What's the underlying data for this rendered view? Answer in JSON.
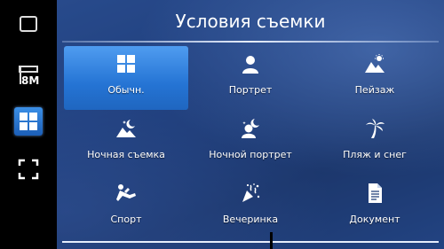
{
  "dialog": {
    "title": "Условия съемки"
  },
  "sidebar": {
    "items": [
      {
        "name": "thumbnail",
        "icon": "thumbnail-icon"
      },
      {
        "name": "resolution",
        "icon": "resolution-icon",
        "label": "8M"
      },
      {
        "name": "scene-mode",
        "icon": "scene-grid-icon",
        "active": true
      },
      {
        "name": "focus",
        "icon": "focus-frame-icon"
      }
    ]
  },
  "scenes": [
    {
      "label": "Обычн.",
      "icon": "grid-icon",
      "selected": true
    },
    {
      "label": "Портрет",
      "icon": "portrait-icon"
    },
    {
      "label": "Пейзаж",
      "icon": "landscape-icon"
    },
    {
      "label": "Ночная съемка",
      "icon": "night-scene-icon"
    },
    {
      "label": "Ночной портрет",
      "icon": "night-portrait-icon"
    },
    {
      "label": "Пляж и снег",
      "icon": "beach-snow-icon"
    },
    {
      "label": "Спорт",
      "icon": "sport-icon"
    },
    {
      "label": "Вечеринка",
      "icon": "party-icon"
    },
    {
      "label": "Документ",
      "icon": "document-icon"
    }
  ],
  "colors": {
    "accent": "#2f7fe0",
    "background": "#1c3670"
  }
}
